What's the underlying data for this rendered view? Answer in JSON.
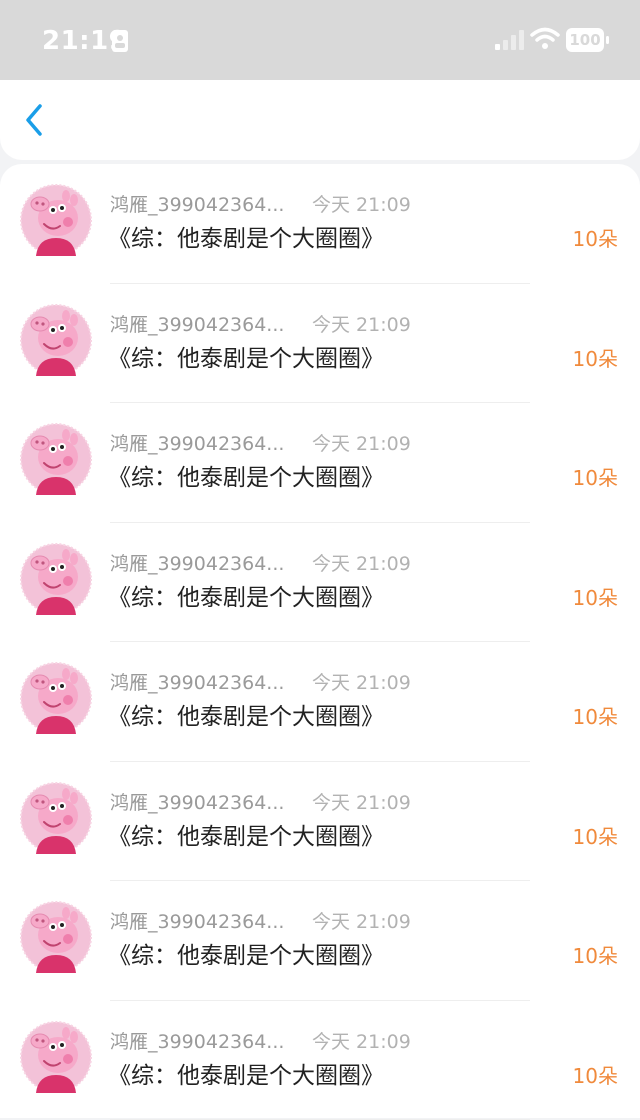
{
  "status_bar": {
    "time": "21:19",
    "battery": "100",
    "icons": [
      "id-card-icon",
      "signal-icon",
      "wifi-icon",
      "battery-icon"
    ]
  },
  "nav": {
    "back_icon": "chevron-left-icon",
    "accent_color": "#1a9ee8"
  },
  "colors": {
    "count": "#f08a3c",
    "username": "#9a9a9a",
    "title": "#222222"
  },
  "records": [
    {
      "user": "鸿雁_399042364...",
      "time": "今天 21:09",
      "title": "《综：他泰剧是个大圈圈》",
      "count": "10朵",
      "avatar": "peppa-pig-avatar"
    },
    {
      "user": "鸿雁_399042364...",
      "time": "今天 21:09",
      "title": "《综：他泰剧是个大圈圈》",
      "count": "10朵",
      "avatar": "peppa-pig-avatar"
    },
    {
      "user": "鸿雁_399042364...",
      "time": "今天 21:09",
      "title": "《综：他泰剧是个大圈圈》",
      "count": "10朵",
      "avatar": "peppa-pig-avatar"
    },
    {
      "user": "鸿雁_399042364...",
      "time": "今天 21:09",
      "title": "《综：他泰剧是个大圈圈》",
      "count": "10朵",
      "avatar": "peppa-pig-avatar"
    },
    {
      "user": "鸿雁_399042364...",
      "time": "今天 21:09",
      "title": "《综：他泰剧是个大圈圈》",
      "count": "10朵",
      "avatar": "peppa-pig-avatar"
    },
    {
      "user": "鸿雁_399042364...",
      "time": "今天 21:09",
      "title": "《综：他泰剧是个大圈圈》",
      "count": "10朵",
      "avatar": "peppa-pig-avatar"
    },
    {
      "user": "鸿雁_399042364...",
      "time": "今天 21:09",
      "title": "《综：他泰剧是个大圈圈》",
      "count": "10朵",
      "avatar": "peppa-pig-avatar"
    },
    {
      "user": "鸿雁_399042364...",
      "time": "今天 21:09",
      "title": "《综：他泰剧是个大圈圈》",
      "count": "10朵",
      "avatar": "peppa-pig-avatar"
    }
  ]
}
